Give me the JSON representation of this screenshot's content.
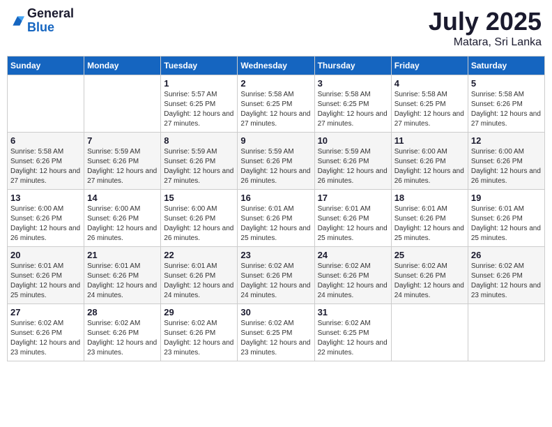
{
  "header": {
    "logo_general": "General",
    "logo_blue": "Blue",
    "month": "July 2025",
    "location": "Matara, Sri Lanka"
  },
  "days_of_week": [
    "Sunday",
    "Monday",
    "Tuesday",
    "Wednesday",
    "Thursday",
    "Friday",
    "Saturday"
  ],
  "weeks": [
    [
      {
        "day": "",
        "info": ""
      },
      {
        "day": "",
        "info": ""
      },
      {
        "day": "1",
        "info": "Sunrise: 5:57 AM\nSunset: 6:25 PM\nDaylight: 12 hours and 27 minutes."
      },
      {
        "day": "2",
        "info": "Sunrise: 5:58 AM\nSunset: 6:25 PM\nDaylight: 12 hours and 27 minutes."
      },
      {
        "day": "3",
        "info": "Sunrise: 5:58 AM\nSunset: 6:25 PM\nDaylight: 12 hours and 27 minutes."
      },
      {
        "day": "4",
        "info": "Sunrise: 5:58 AM\nSunset: 6:25 PM\nDaylight: 12 hours and 27 minutes."
      },
      {
        "day": "5",
        "info": "Sunrise: 5:58 AM\nSunset: 6:26 PM\nDaylight: 12 hours and 27 minutes."
      }
    ],
    [
      {
        "day": "6",
        "info": "Sunrise: 5:58 AM\nSunset: 6:26 PM\nDaylight: 12 hours and 27 minutes."
      },
      {
        "day": "7",
        "info": "Sunrise: 5:59 AM\nSunset: 6:26 PM\nDaylight: 12 hours and 27 minutes."
      },
      {
        "day": "8",
        "info": "Sunrise: 5:59 AM\nSunset: 6:26 PM\nDaylight: 12 hours and 27 minutes."
      },
      {
        "day": "9",
        "info": "Sunrise: 5:59 AM\nSunset: 6:26 PM\nDaylight: 12 hours and 26 minutes."
      },
      {
        "day": "10",
        "info": "Sunrise: 5:59 AM\nSunset: 6:26 PM\nDaylight: 12 hours and 26 minutes."
      },
      {
        "day": "11",
        "info": "Sunrise: 6:00 AM\nSunset: 6:26 PM\nDaylight: 12 hours and 26 minutes."
      },
      {
        "day": "12",
        "info": "Sunrise: 6:00 AM\nSunset: 6:26 PM\nDaylight: 12 hours and 26 minutes."
      }
    ],
    [
      {
        "day": "13",
        "info": "Sunrise: 6:00 AM\nSunset: 6:26 PM\nDaylight: 12 hours and 26 minutes."
      },
      {
        "day": "14",
        "info": "Sunrise: 6:00 AM\nSunset: 6:26 PM\nDaylight: 12 hours and 26 minutes."
      },
      {
        "day": "15",
        "info": "Sunrise: 6:00 AM\nSunset: 6:26 PM\nDaylight: 12 hours and 26 minutes."
      },
      {
        "day": "16",
        "info": "Sunrise: 6:01 AM\nSunset: 6:26 PM\nDaylight: 12 hours and 25 minutes."
      },
      {
        "day": "17",
        "info": "Sunrise: 6:01 AM\nSunset: 6:26 PM\nDaylight: 12 hours and 25 minutes."
      },
      {
        "day": "18",
        "info": "Sunrise: 6:01 AM\nSunset: 6:26 PM\nDaylight: 12 hours and 25 minutes."
      },
      {
        "day": "19",
        "info": "Sunrise: 6:01 AM\nSunset: 6:26 PM\nDaylight: 12 hours and 25 minutes."
      }
    ],
    [
      {
        "day": "20",
        "info": "Sunrise: 6:01 AM\nSunset: 6:26 PM\nDaylight: 12 hours and 25 minutes."
      },
      {
        "day": "21",
        "info": "Sunrise: 6:01 AM\nSunset: 6:26 PM\nDaylight: 12 hours and 24 minutes."
      },
      {
        "day": "22",
        "info": "Sunrise: 6:01 AM\nSunset: 6:26 PM\nDaylight: 12 hours and 24 minutes."
      },
      {
        "day": "23",
        "info": "Sunrise: 6:02 AM\nSunset: 6:26 PM\nDaylight: 12 hours and 24 minutes."
      },
      {
        "day": "24",
        "info": "Sunrise: 6:02 AM\nSunset: 6:26 PM\nDaylight: 12 hours and 24 minutes."
      },
      {
        "day": "25",
        "info": "Sunrise: 6:02 AM\nSunset: 6:26 PM\nDaylight: 12 hours and 24 minutes."
      },
      {
        "day": "26",
        "info": "Sunrise: 6:02 AM\nSunset: 6:26 PM\nDaylight: 12 hours and 23 minutes."
      }
    ],
    [
      {
        "day": "27",
        "info": "Sunrise: 6:02 AM\nSunset: 6:26 PM\nDaylight: 12 hours and 23 minutes."
      },
      {
        "day": "28",
        "info": "Sunrise: 6:02 AM\nSunset: 6:26 PM\nDaylight: 12 hours and 23 minutes."
      },
      {
        "day": "29",
        "info": "Sunrise: 6:02 AM\nSunset: 6:26 PM\nDaylight: 12 hours and 23 minutes."
      },
      {
        "day": "30",
        "info": "Sunrise: 6:02 AM\nSunset: 6:25 PM\nDaylight: 12 hours and 23 minutes."
      },
      {
        "day": "31",
        "info": "Sunrise: 6:02 AM\nSunset: 6:25 PM\nDaylight: 12 hours and 22 minutes."
      },
      {
        "day": "",
        "info": ""
      },
      {
        "day": "",
        "info": ""
      }
    ]
  ]
}
